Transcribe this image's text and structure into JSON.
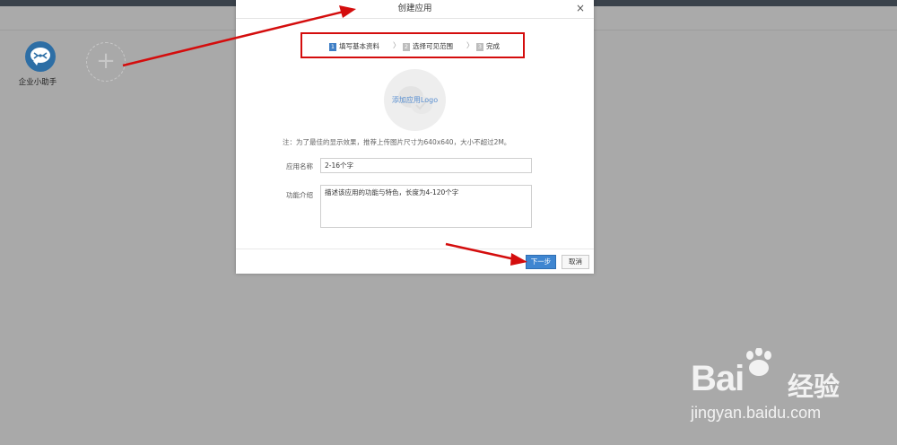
{
  "app": {
    "tiles": [
      {
        "label": "企业小助手",
        "icon": "chat-bubble-icon"
      }
    ],
    "add_icon": "plus-icon"
  },
  "modal": {
    "title": "创建应用",
    "close_glyph": "×",
    "steps": [
      {
        "num": "1",
        "label": "填写基本资料",
        "active": true
      },
      {
        "num": "2",
        "label": "选择可见范围",
        "active": false
      },
      {
        "num": "3",
        "label": "完成",
        "active": false
      }
    ],
    "step_separator": "〉",
    "logo_upload_text": "添加应用Logo",
    "note": "注：为了最佳的显示效果，推荐上传图片尺寸为640x640，大小不超过2M。",
    "fields": {
      "name_label": "应用名称",
      "name_placeholder": "2-16个字",
      "desc_label": "功能介绍",
      "desc_placeholder": "描述该应用的功能与特色，长度为4-120个字"
    },
    "buttons": {
      "next": "下一步",
      "cancel": "取消"
    }
  },
  "watermark": {
    "brand": "Bai",
    "brand_cn": "经验",
    "url": "jingyan.baidu.com"
  },
  "colors": {
    "accent": "#3f86d1",
    "annotation": "#d40d0d",
    "app_icon": "#2d6ea5"
  }
}
